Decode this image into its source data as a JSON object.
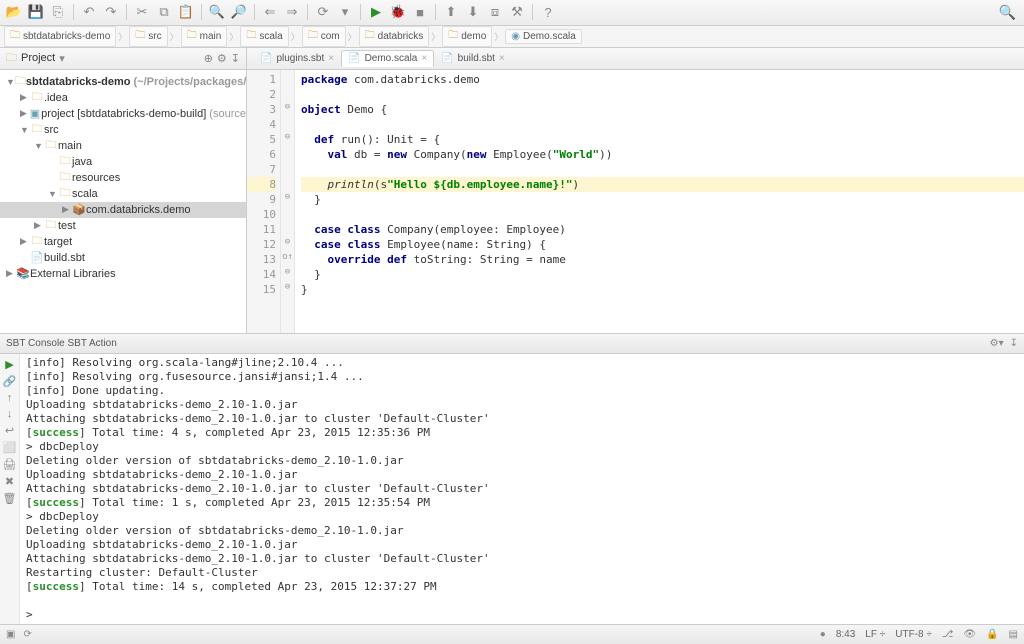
{
  "toolbar": {
    "icons": [
      "open",
      "save",
      "export",
      "undo",
      "redo",
      "cut",
      "copy",
      "paste",
      "zoom-in",
      "zoom-out",
      "back",
      "fwd",
      "sync",
      "dropdown",
      "run",
      "debug",
      "stop",
      "vcs-up",
      "vcs-down",
      "vcs-stash",
      "build",
      "help"
    ]
  },
  "breadcrumb": [
    {
      "icon": "folder",
      "label": "sbtdatabricks-demo"
    },
    {
      "icon": "folder",
      "label": "src"
    },
    {
      "icon": "folder",
      "label": "main"
    },
    {
      "icon": "folder",
      "label": "scala"
    },
    {
      "icon": "folder",
      "label": "com"
    },
    {
      "icon": "folder",
      "label": "databricks"
    },
    {
      "icon": "folder",
      "label": "demo"
    },
    {
      "icon": "file",
      "label": "Demo.scala"
    }
  ],
  "project": {
    "title": "Project",
    "tree": [
      {
        "depth": 0,
        "toggle": "▼",
        "icon": "folder",
        "label": "sbtdatabricks-demo",
        "suffix": " (~/Projects/packages/sbt",
        "bold": true
      },
      {
        "depth": 1,
        "toggle": "▶",
        "icon": "folder",
        "label": ".idea"
      },
      {
        "depth": 1,
        "toggle": "▶",
        "icon": "module",
        "label": "project [sbtdatabricks-demo-build]",
        "suffix": " (source"
      },
      {
        "depth": 1,
        "toggle": "▼",
        "icon": "folder",
        "label": "src"
      },
      {
        "depth": 2,
        "toggle": "▼",
        "icon": "folder",
        "label": "main"
      },
      {
        "depth": 3,
        "toggle": "",
        "icon": "folder",
        "label": "java"
      },
      {
        "depth": 3,
        "toggle": "",
        "icon": "folder",
        "label": "resources"
      },
      {
        "depth": 3,
        "toggle": "▼",
        "icon": "folder",
        "label": "scala"
      },
      {
        "depth": 4,
        "toggle": "▶",
        "icon": "package",
        "label": "com.databricks.demo",
        "selected": true
      },
      {
        "depth": 2,
        "toggle": "▶",
        "icon": "folder",
        "label": "test"
      },
      {
        "depth": 1,
        "toggle": "▶",
        "icon": "folder",
        "label": "target"
      },
      {
        "depth": 1,
        "toggle": "",
        "icon": "file",
        "label": "build.sbt"
      },
      {
        "depth": 0,
        "toggle": "▶",
        "icon": "lib",
        "label": "External Libraries"
      }
    ]
  },
  "tabs": [
    {
      "label": "plugins.sbt",
      "active": false
    },
    {
      "label": "Demo.scala",
      "active": true
    },
    {
      "label": "build.sbt",
      "active": false
    }
  ],
  "code": {
    "lines": [
      {
        "n": 1,
        "mark": "",
        "kw": "package ",
        "rest": "com.databricks.demo"
      },
      {
        "n": 2,
        "mark": "",
        "rest": ""
      },
      {
        "n": 3,
        "mark": "⊖",
        "kw": "object ",
        "rest": "Demo {"
      },
      {
        "n": 4,
        "mark": "",
        "rest": ""
      },
      {
        "n": 5,
        "mark": "⊖",
        "pad": "  ",
        "kw": "def ",
        "rest": "run(): Unit = {"
      },
      {
        "n": 6,
        "mark": "",
        "pad": "    ",
        "kw": "val ",
        "rest": "db = ",
        "kw2": "new ",
        "rest2": "Company(",
        "kw3": "new ",
        "rest3": "Employee(",
        "str": "\"World\"",
        "tail": "))"
      },
      {
        "n": 7,
        "mark": "",
        "rest": ""
      },
      {
        "n": 8,
        "mark": "",
        "hl": true,
        "pad": "    ",
        "ital": "println",
        "rest": "(s",
        "str": "\"Hello ${db.employee.name}!\"",
        "tail": ")"
      },
      {
        "n": 9,
        "mark": "⊖",
        "pad": "  ",
        "rest": "}"
      },
      {
        "n": 10,
        "mark": "",
        "rest": ""
      },
      {
        "n": 11,
        "mark": "",
        "pad": "  ",
        "kw": "case class ",
        "rest": "Company(employee: Employee)"
      },
      {
        "n": 12,
        "mark": "⊖",
        "pad": "  ",
        "kw": "case class ",
        "rest": "Employee(name: String) {"
      },
      {
        "n": 13,
        "mark": "o↑",
        "pad": "    ",
        "kw": "override def ",
        "rest": "toString: String = name"
      },
      {
        "n": 14,
        "mark": "⊖",
        "pad": "  ",
        "rest": "}"
      },
      {
        "n": 15,
        "mark": "⊖",
        "rest": "}"
      }
    ]
  },
  "console": {
    "title": "SBT Console SBT Action",
    "lines": [
      "[info] Resolving org.scala-lang#jline;2.10.4 ...",
      "[info] Resolving org.fusesource.jansi#jansi;1.4 ...",
      "[info] Done updating.",
      "Uploading sbtdatabricks-demo_2.10-1.0.jar",
      "Attaching sbtdatabricks-demo_2.10-1.0.jar to cluster 'Default-Cluster'",
      "[__SUCCESS__] Total time: 4 s, completed Apr 23, 2015 12:35:36 PM",
      "> dbcDeploy",
      "Deleting older version of sbtdatabricks-demo_2.10-1.0.jar",
      "Uploading sbtdatabricks-demo_2.10-1.0.jar",
      "Attaching sbtdatabricks-demo_2.10-1.0.jar to cluster 'Default-Cluster'",
      "[__SUCCESS__] Total time: 1 s, completed Apr 23, 2015 12:35:54 PM",
      "> dbcDeploy",
      "Deleting older version of sbtdatabricks-demo_2.10-1.0.jar",
      "Uploading sbtdatabricks-demo_2.10-1.0.jar",
      "Attaching sbtdatabricks-demo_2.10-1.0.jar to cluster 'Default-Cluster'",
      "Restarting cluster: Default-Cluster",
      "[__SUCCESS__] Total time: 14 s, completed Apr 23, 2015 12:37:27 PM",
      "",
      "> "
    ]
  },
  "status": {
    "pos": "8:43",
    "lf": "LF",
    "enc": "UTF-8"
  }
}
